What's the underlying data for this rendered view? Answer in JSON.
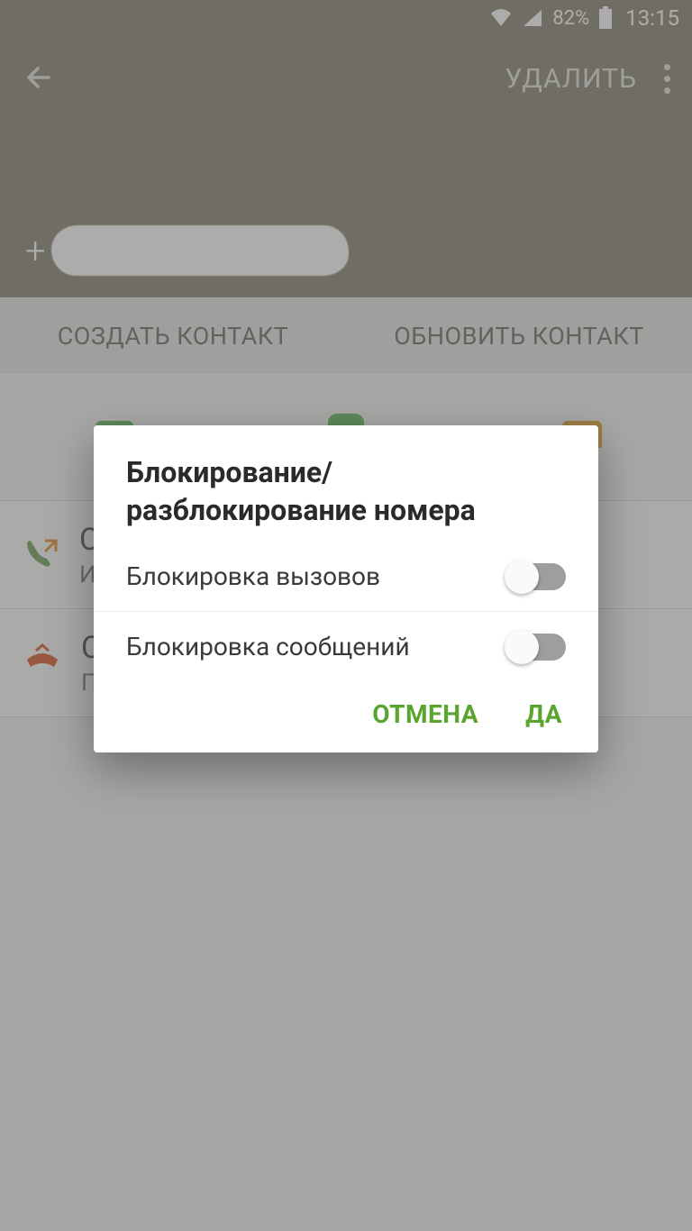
{
  "statusbar": {
    "battery_pct": "82%",
    "time": "13:15"
  },
  "appbar": {
    "delete_label": "УДАЛИТЬ",
    "phone_prefix": "+"
  },
  "contactbar": {
    "create_label": "СОЗДАТЬ КОНТАКТ",
    "update_label": "ОБНОВИТЬ КОНТАКТ"
  },
  "log": {
    "row1_line1": "С",
    "row1_line2": "И",
    "row2_line1": "С",
    "row2_line2": "П"
  },
  "dialog": {
    "title": "Блокирование/ разблокирование номера",
    "block_calls_label": "Блокировка вызовов",
    "block_sms_label": "Блокировка сообщений",
    "cancel_label": "ОТМЕНА",
    "ok_label": "ДА"
  }
}
